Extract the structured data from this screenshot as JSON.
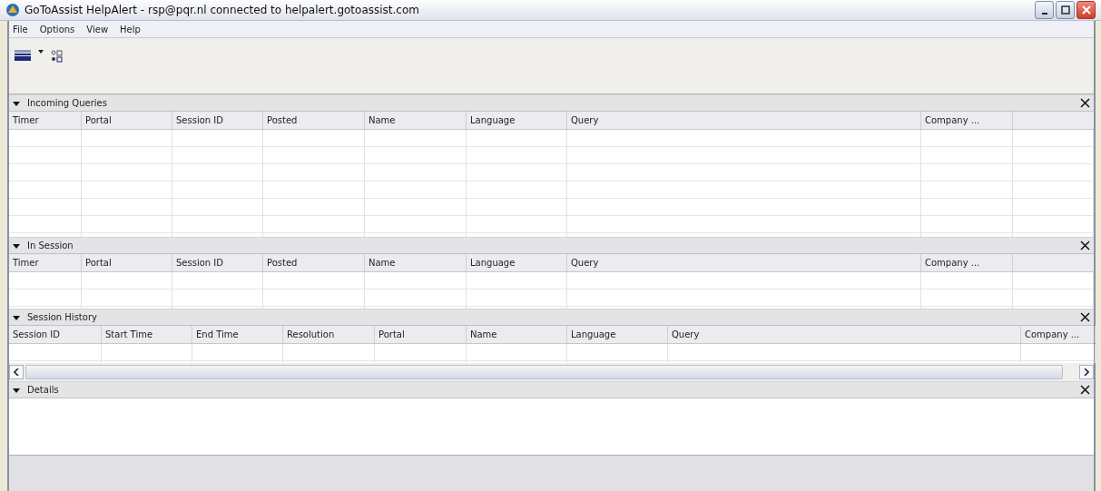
{
  "window": {
    "title": "GoToAssist HelpAlert - rsp@pqr.nl connected to helpalert.gotoassist.com"
  },
  "menu": [
    "File",
    "Options",
    "View",
    "Help"
  ],
  "sections": [
    {
      "kind": "table",
      "title": "Incoming Queries",
      "expanded": true,
      "columns": [
        "Timer",
        "Portal",
        "Session ID",
        "Posted",
        "Name",
        "Language",
        "Query",
        "Company ..."
      ]
    },
    {
      "kind": "table",
      "title": "In Session",
      "expanded": true,
      "columns": [
        "Timer",
        "Portal",
        "Session ID",
        "Posted",
        "Name",
        "Language",
        "Query",
        "Company ..."
      ]
    },
    {
      "kind": "table-scroll",
      "title": "Session History",
      "expanded": true,
      "columns": [
        "Session ID",
        "Start Time",
        "End Time",
        "Resolution",
        "Portal",
        "Name",
        "Language",
        "Query",
        "Company ..."
      ]
    },
    {
      "kind": "details",
      "title": "Details",
      "expanded": true
    }
  ]
}
